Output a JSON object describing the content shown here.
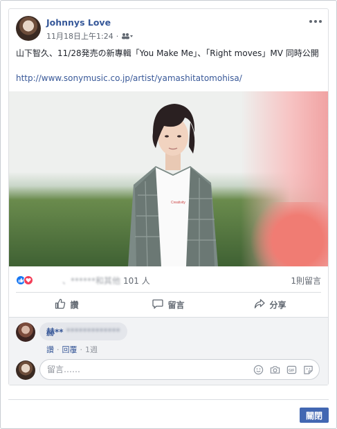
{
  "post": {
    "author": "Johnnys Love",
    "timestamp": "11月18日上午1:24",
    "text": "山下智久、11/28発売の新專輯「You Make Me」、「Right moves」MV 同時公開",
    "link": "http://www.sonymusic.co.jp/artist/yamashitatomohisa/"
  },
  "reactions": {
    "names_blurred": "　　　、******和其他",
    "count": "101 人",
    "comments_count": "1則留言"
  },
  "actions": {
    "like": "讚",
    "comment": "留言",
    "share": "分享"
  },
  "comment": {
    "author": "赫**",
    "text_blurred": "*************",
    "like": "讚",
    "reply": "回覆",
    "time": "1週"
  },
  "comment_input": {
    "placeholder": "留言……"
  },
  "footer": {
    "close_label": "關閉"
  }
}
